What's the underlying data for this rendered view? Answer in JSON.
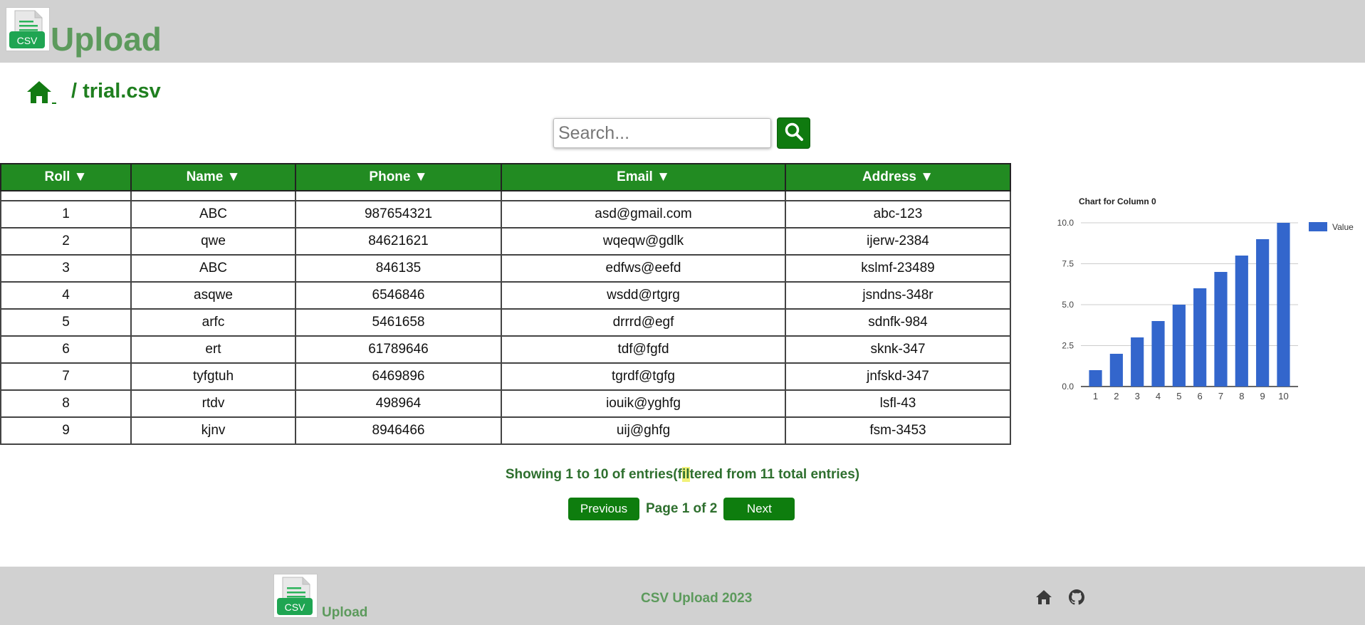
{
  "brand": {
    "name": "Upload",
    "logo_text": "CSV",
    "icon": "csv-file-icon"
  },
  "breadcrumb": {
    "home_icon": "home-icon",
    "path": "/ trial.csv"
  },
  "search": {
    "placeholder": "Search...",
    "value": "",
    "icon": "search-icon"
  },
  "table": {
    "columns": [
      "Roll ▼",
      "Name ▼",
      "Phone ▼",
      "Email ▼",
      "Address ▼"
    ],
    "rows": [
      [
        "1",
        "ABC",
        "987654321",
        "asd@gmail.com",
        "abc-123"
      ],
      [
        "2",
        "qwe",
        "84621621",
        "wqeqw@gdlk",
        "ijerw-2384"
      ],
      [
        "3",
        "ABC",
        "846135",
        "edfws@eefd",
        "kslmf-23489"
      ],
      [
        "4",
        "asqwe",
        "6546846",
        "wsdd@rtgrg",
        "jsndns-348r"
      ],
      [
        "5",
        "arfc",
        "5461658",
        "drrrd@egf",
        "sdnfk-984"
      ],
      [
        "6",
        "ert",
        "61789646",
        "tdf@fgfd",
        "sknk-347"
      ],
      [
        "7",
        "tyfgtuh",
        "6469896",
        "tgrdf@tgfg",
        "jnfskd-347"
      ],
      [
        "8",
        "rtdv",
        "498964",
        "iouik@yghfg",
        "lsfl-43"
      ],
      [
        "9",
        "kjnv",
        "8946466",
        "uij@ghfg",
        "fsm-3453"
      ]
    ]
  },
  "pagination": {
    "info_prefix": "Showing 1 to 10 of entries(f",
    "info_highlight": "il",
    "info_suffix": "tered from 11 total entries)",
    "previous": "Previous",
    "page_label": "Page 1 of 2",
    "next": "Next"
  },
  "chart_data": {
    "type": "bar",
    "title": "Chart for Column 0",
    "categories": [
      "1",
      "2",
      "3",
      "4",
      "5",
      "6",
      "7",
      "8",
      "9",
      "10"
    ],
    "series": [
      {
        "name": "Value",
        "values": [
          1,
          2,
          3,
          4,
          5,
          6,
          7,
          8,
          9,
          10
        ]
      }
    ],
    "y_ticks": [
      "0.0",
      "2.5",
      "5.0",
      "7.5",
      "10.0"
    ],
    "ylim": [
      0,
      10
    ],
    "grid": true,
    "legend_position": "right",
    "bar_color": "#3366cc"
  },
  "footer": {
    "brand": "Upload",
    "logo_text": "CSV",
    "copyright": "CSV Upload 2023",
    "icons": [
      "home-icon",
      "github-icon"
    ]
  },
  "colors": {
    "accent": "#228b22",
    "button": "#0e7d0e",
    "brand": "#5c9a5c",
    "bar": "#3366cc"
  }
}
